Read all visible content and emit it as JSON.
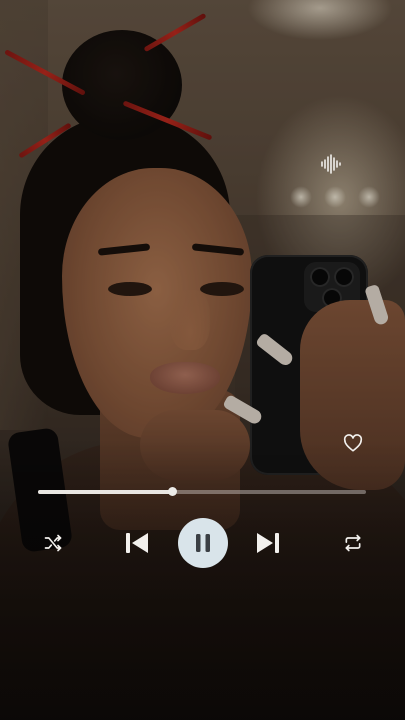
{
  "player": {
    "progress": 0.41,
    "state": "playing",
    "colors": {
      "accent": "#d9e4ea",
      "icon": "#f2f0ed",
      "track": "#e9e6e2"
    }
  },
  "icons": {
    "soundwave": "soundwave-icon",
    "like": "heart-outline-icon",
    "shuffle": "shuffle-icon",
    "previous": "skip-previous-icon",
    "pause": "pause-icon",
    "next": "skip-next-icon",
    "repeat": "repeat-icon"
  }
}
